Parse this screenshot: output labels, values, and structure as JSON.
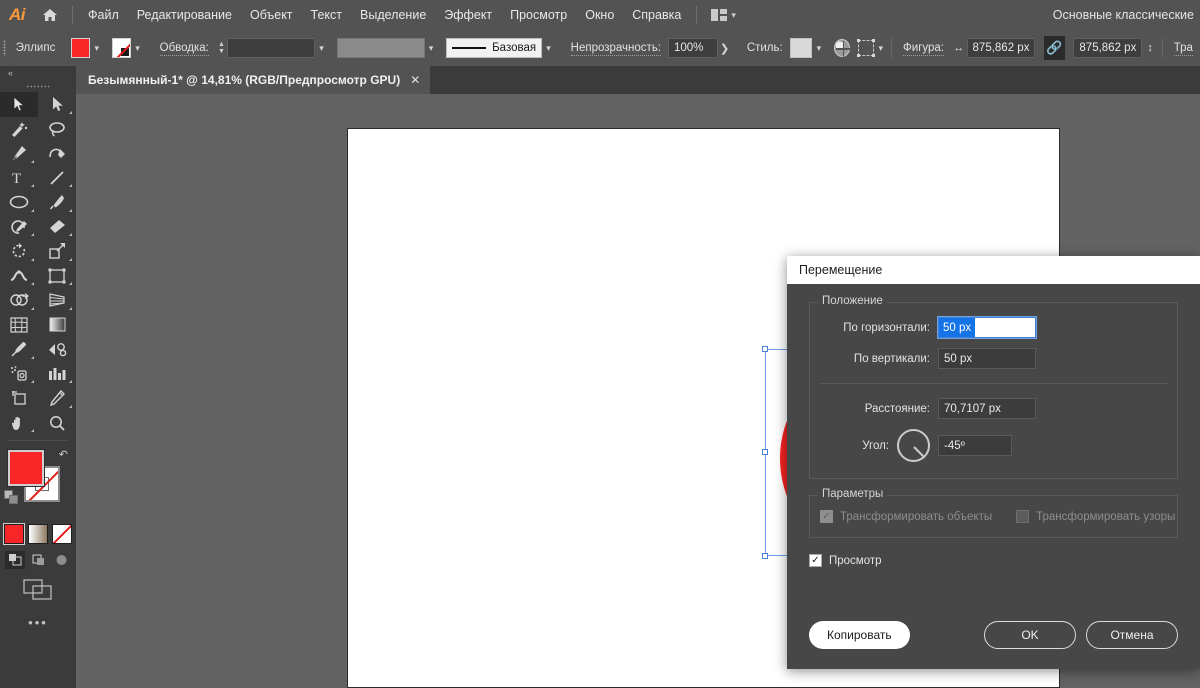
{
  "app": {
    "logo": "Ai",
    "home_icon": "home-icon",
    "workspace": "Основные классические"
  },
  "menu": {
    "items": [
      {
        "label": "Файл"
      },
      {
        "label": "Редактирование"
      },
      {
        "label": "Объект"
      },
      {
        "label": "Текст"
      },
      {
        "label": "Выделение"
      },
      {
        "label": "Эффект"
      },
      {
        "label": "Просмотр"
      },
      {
        "label": "Окно"
      },
      {
        "label": "Справка"
      }
    ],
    "arrange_icon": "arrange-documents-icon",
    "arrange_chevron": "chevron-down-icon"
  },
  "options_bar": {
    "tool_name": "Эллипс",
    "fill_swatch": "#F82626",
    "fill_chevron": "chevron-down-icon",
    "stroke_swatch": "none-swatch-icon",
    "stroke_chevron": "chevron-down-icon",
    "stroke_label": "Обводка:",
    "stroke_weight_value": "",
    "stroke_weight_chevron": "chevron-down-icon",
    "stroke_profile_value": "",
    "stroke_profile_chevron": "chevron-down-icon",
    "stroke_style_label": "Базовая",
    "stroke_style_chevron": "chevron-down-icon",
    "opacity_label": "Непрозрачность:",
    "opacity_value": "100%",
    "opacity_arrow": "chevron-right-icon",
    "style_label": "Стиль:",
    "style_chevron": "chevron-down-icon",
    "recolor_icon": "recolor-artwork-icon",
    "align_icon": "align-icon",
    "align_chevron": "chevron-down-icon",
    "shape_label": "Фигура:",
    "width_icon": "width-icon",
    "width_value": "875,862 px",
    "link_icon": "link-dimensions-icon",
    "height_value": "875,862 px",
    "height_icon": "height-icon",
    "transform_label": "Тра"
  },
  "tab": {
    "title": "Безымянный-1* @ 14,81% (RGB/Предпросмотр GPU)",
    "close_icon": "close-icon"
  },
  "toolbar": {
    "collapse_icon": "collapse-panel-icon",
    "grip": "drag-handle",
    "tools": [
      {
        "name": "selection-tool",
        "icon": "arrow-solid",
        "active": true,
        "corner": false
      },
      {
        "name": "direct-selection-tool",
        "icon": "arrow-hollow",
        "active": false,
        "corner": true
      },
      {
        "name": "magic-wand-tool",
        "icon": "magic-wand",
        "active": false,
        "corner": false
      },
      {
        "name": "lasso-tool",
        "icon": "lasso",
        "active": false,
        "corner": false
      },
      {
        "name": "pen-tool",
        "icon": "pen",
        "active": false,
        "corner": true
      },
      {
        "name": "curvature-tool",
        "icon": "curvature",
        "active": false,
        "corner": false
      },
      {
        "name": "type-tool",
        "icon": "type",
        "active": false,
        "corner": true
      },
      {
        "name": "line-segment-tool",
        "icon": "line",
        "active": false,
        "corner": true
      },
      {
        "name": "ellipse-tool",
        "icon": "ellipse",
        "active": false,
        "corner": true
      },
      {
        "name": "paintbrush-tool",
        "icon": "paintbrush",
        "active": false,
        "corner": true
      },
      {
        "name": "shaper-tool",
        "icon": "shaper",
        "active": false,
        "corner": true
      },
      {
        "name": "eraser-tool",
        "icon": "eraser",
        "active": false,
        "corner": true
      },
      {
        "name": "rotate-tool",
        "icon": "rotate",
        "active": false,
        "corner": true
      },
      {
        "name": "scale-tool",
        "icon": "scale",
        "active": false,
        "corner": true
      },
      {
        "name": "width-tool",
        "icon": "width-warp",
        "active": false,
        "corner": true
      },
      {
        "name": "free-transform-tool",
        "icon": "free-transform",
        "active": false,
        "corner": true
      },
      {
        "name": "shape-builder-tool",
        "icon": "shape-builder",
        "active": false,
        "corner": true
      },
      {
        "name": "perspective-grid-tool",
        "icon": "perspective-grid",
        "active": false,
        "corner": true
      },
      {
        "name": "mesh-tool",
        "icon": "mesh",
        "active": false,
        "corner": false
      },
      {
        "name": "gradient-tool",
        "icon": "gradient",
        "active": false,
        "corner": false
      },
      {
        "name": "eyedropper-tool",
        "icon": "eyedropper",
        "active": false,
        "corner": true
      },
      {
        "name": "blend-tool",
        "icon": "blend",
        "active": false,
        "corner": false
      },
      {
        "name": "symbol-sprayer-tool",
        "icon": "symbol-sprayer",
        "active": false,
        "corner": true
      },
      {
        "name": "column-graph-tool",
        "icon": "column-graph",
        "active": false,
        "corner": true
      },
      {
        "name": "artboard-tool",
        "icon": "artboard",
        "active": false,
        "corner": false
      },
      {
        "name": "slice-tool",
        "icon": "slice",
        "active": false,
        "corner": true
      },
      {
        "name": "hand-tool",
        "icon": "hand",
        "active": false,
        "corner": true
      },
      {
        "name": "zoom-tool",
        "icon": "zoom",
        "active": false,
        "corner": false
      }
    ],
    "fill_color": "#F82626",
    "stroke_color": "#FFFFFF",
    "swap_icon": "swap-fill-stroke-icon",
    "default_icon": "default-fill-stroke-icon",
    "color_modes": [
      {
        "name": "color-mode-color",
        "selected": true
      },
      {
        "name": "color-mode-gradient",
        "selected": false
      },
      {
        "name": "color-mode-none",
        "selected": false
      }
    ],
    "draw_modes": [
      {
        "name": "draw-normal",
        "active": true
      },
      {
        "name": "draw-behind",
        "active": false
      },
      {
        "name": "draw-inside",
        "active": false
      }
    ],
    "screen_mode_icon": "change-screen-mode-icon",
    "more_icon": "edit-toolbar-icon"
  },
  "canvas": {
    "shape_fill": "#F72323",
    "selection_color": "#6E9CE8",
    "shape_name": "red-ellipse"
  },
  "dialog": {
    "title": "Перемещение",
    "position_group": {
      "legend": "Положение",
      "horizontal_label": "По горизонтали:",
      "horizontal_value": "50 px",
      "vertical_label": "По вертикали:",
      "vertical_value": "50 px",
      "distance_label": "Расстояние:",
      "distance_value": "70,7107 px",
      "angle_label": "Угол:",
      "angle_value": "-45º",
      "angle_dial_icon": "angle-dial"
    },
    "params_group": {
      "legend": "Параметры",
      "transform_objects_label": "Трансформировать объекты",
      "transform_objects_checked": true,
      "transform_objects_disabled": true,
      "transform_patterns_label": "Трансформировать узоры",
      "transform_patterns_checked": false,
      "transform_patterns_disabled": true
    },
    "preview_label": "Просмотр",
    "preview_checked": true,
    "buttons": {
      "copy": "Копировать",
      "ok": "OK",
      "cancel": "Отмена"
    },
    "accent": "#1473E6"
  }
}
